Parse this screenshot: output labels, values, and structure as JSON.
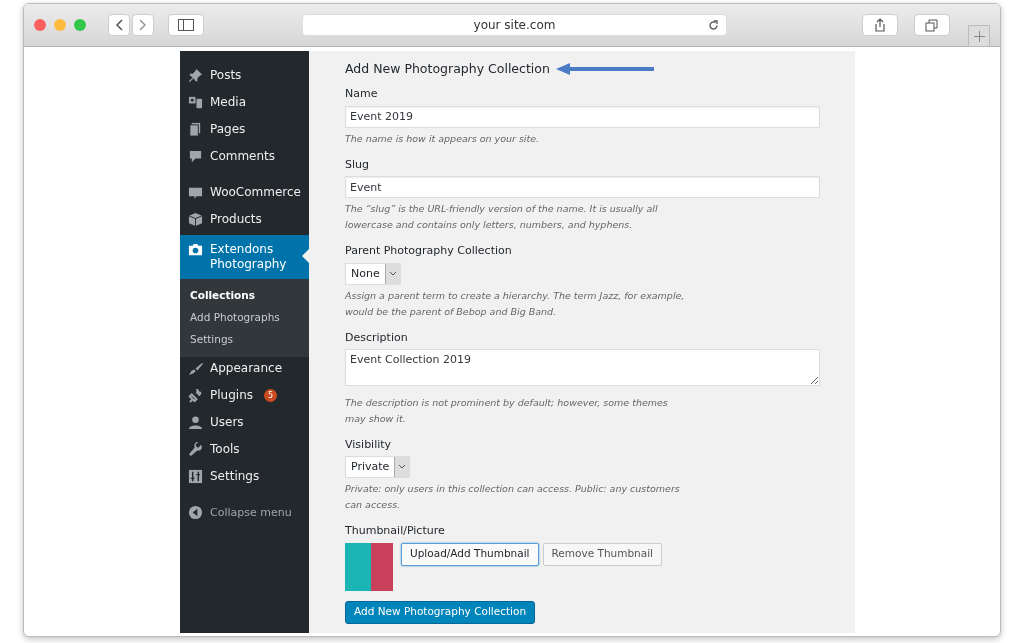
{
  "browser": {
    "url": "your site.com"
  },
  "sidebar": {
    "groups": [
      {
        "items": [
          {
            "label": "Posts",
            "selected": false
          },
          {
            "label": "Media",
            "selected": false
          },
          {
            "label": "Pages",
            "selected": false
          },
          {
            "label": "Comments",
            "selected": false
          }
        ]
      },
      {
        "items": [
          {
            "label": "WooCommerce",
            "selected": false
          },
          {
            "label": "Products",
            "selected": false
          },
          {
            "label": "Extendons Photography",
            "selected": true,
            "children": [
              {
                "label": "Collections",
                "selected": true
              },
              {
                "label": "Add Photographs",
                "selected": false
              },
              {
                "label": "Settings",
                "selected": false
              }
            ]
          },
          {
            "label": "Appearance",
            "selected": false
          },
          {
            "label": "Plugins",
            "selected": false,
            "badge": "5"
          },
          {
            "label": "Users",
            "selected": false
          },
          {
            "label": "Tools",
            "selected": false
          },
          {
            "label": "Settings",
            "selected": false
          }
        ]
      },
      {
        "items": [
          {
            "label": "Collapse menu",
            "selected": false,
            "kind": "collapse"
          }
        ]
      }
    ]
  },
  "form": {
    "title": "Add New Photography Collection",
    "fields": [
      {
        "kind": "text",
        "label": "Name",
        "value": "Event 2019",
        "description": "The name is how it appears on your site."
      },
      {
        "kind": "text",
        "label": "Slug",
        "value": "Event",
        "description": "The “slug” is the URL-friendly version of the name. It is usually all lowercase and contains only letters, numbers, and hyphens."
      },
      {
        "kind": "select",
        "label": "Parent Photography Collection",
        "value": "None",
        "description": "Assign a parent term to create a hierarchy. The term Jazz, for example, would be the parent of Bebop and Big Band."
      },
      {
        "kind": "textarea",
        "label": "Description",
        "value": "Event Collection 2019",
        "description": "The description is not prominent by default; however, some themes may show it."
      },
      {
        "kind": "select",
        "label": "Visibility",
        "value": "Private",
        "description": "Private: only users in this collection can access. Public: any customers can access."
      },
      {
        "kind": "thumbnail",
        "label": "Thumbnail/Picture",
        "buttons": [
          {
            "label": "Upload/Add Thumbnail",
            "focused": true
          },
          {
            "label": "Remove Thumbnail",
            "focused": false
          }
        ]
      }
    ],
    "submit": "Add New Photography Collection"
  }
}
